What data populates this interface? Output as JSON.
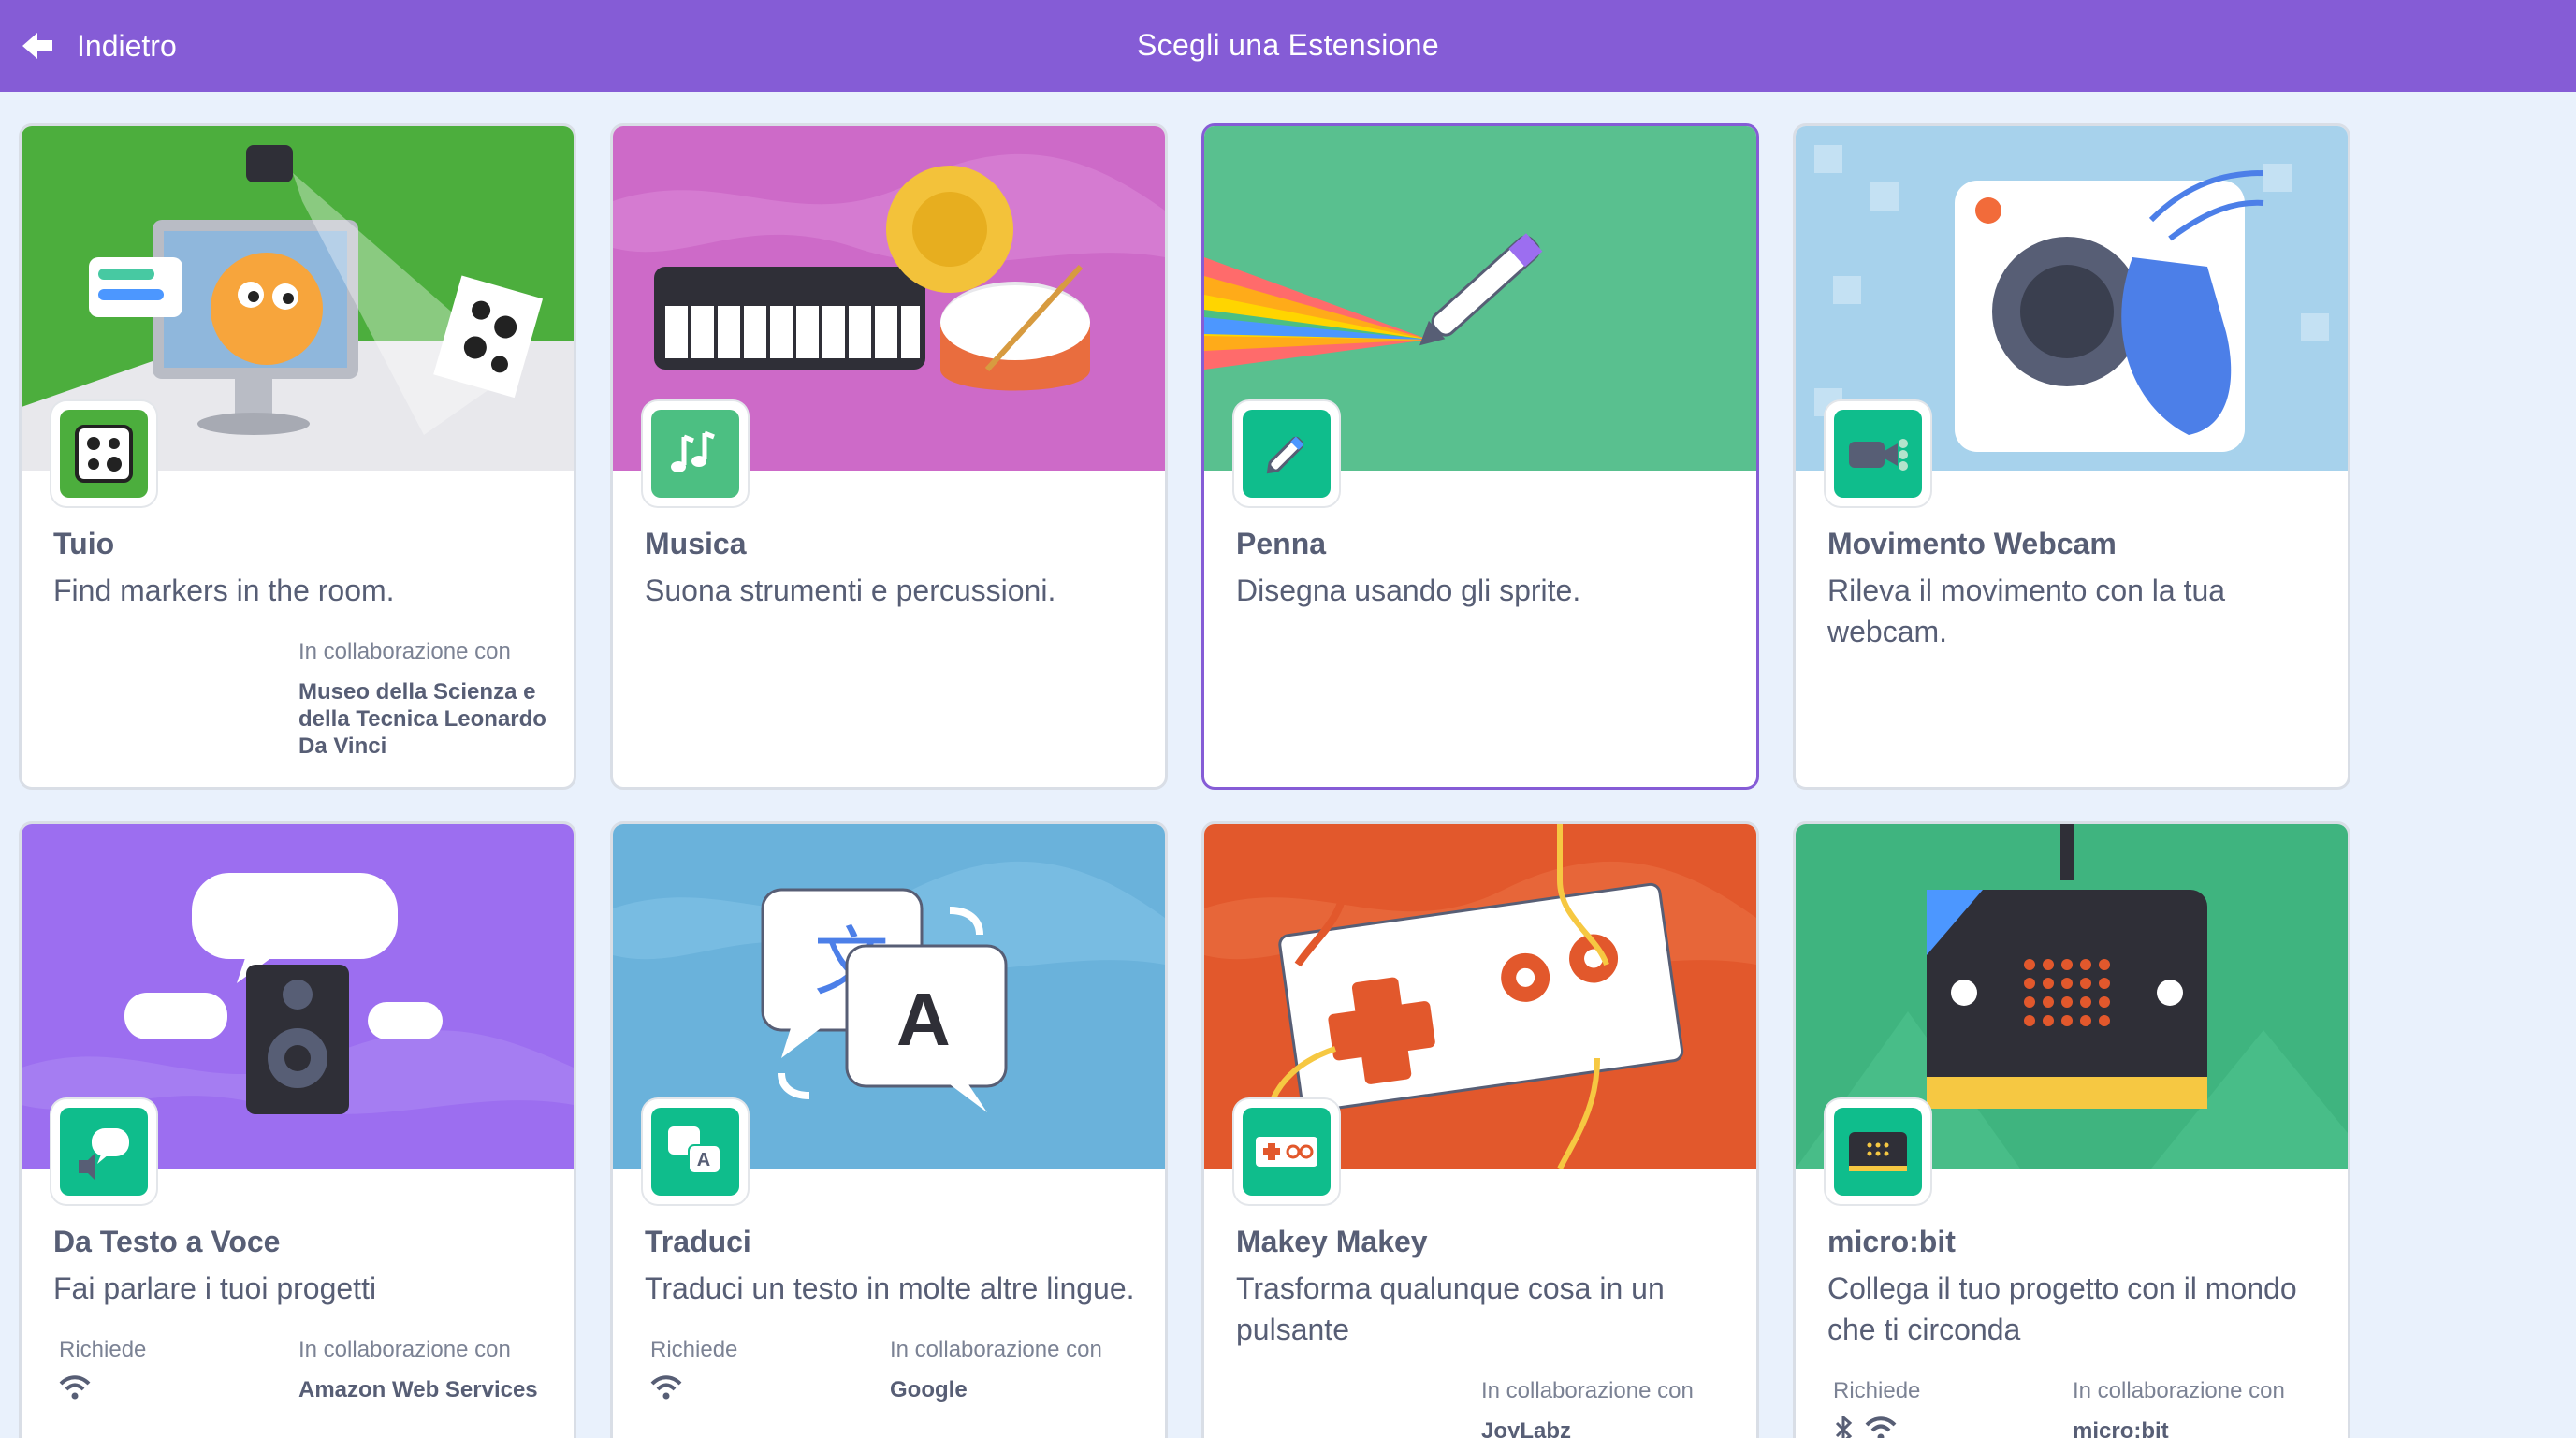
{
  "header": {
    "back_label": "Indietro",
    "title": "Scegli una Estensione",
    "color": "#855cd6"
  },
  "cards": [
    {
      "title": "Tuio",
      "description": "Find markers in the room.",
      "collab_label": "In collaborazione con",
      "collab_name": "Museo della Scienza e della Tecnica Leonardo Da Vinci",
      "bg": "#4cae3d",
      "icon": "tuio-marker-icon"
    },
    {
      "title": "Musica",
      "description": "Suona strumenti e percussioni.",
      "bg": "#cd6ac8",
      "icon": "music-notes-icon"
    },
    {
      "title": "Penna",
      "description": "Disegna usando gli sprite.",
      "bg": "#59c08f",
      "icon": "pen-icon",
      "selected": true
    },
    {
      "title": "Movimento Webcam",
      "description": "Rileva il movimento con la tua webcam.",
      "bg": "#a7d2ec",
      "icon": "video-sensing-icon"
    },
    {
      "title": "Da Testo a Voce",
      "description": "Fai parlare i tuoi progetti",
      "requires_label": "Richiede",
      "requires": [
        "wifi-icon"
      ],
      "collab_label": "In collaborazione con",
      "collab_name": "Amazon Web Services",
      "bg": "#9c6ef0",
      "icon": "speech-bubble-icon"
    },
    {
      "title": "Traduci",
      "description": "Traduci un testo in molte altre lingue.",
      "requires_label": "Richiede",
      "requires": [
        "wifi-icon"
      ],
      "collab_label": "In collaborazione con",
      "collab_name": "Google",
      "bg": "#6ab2db",
      "icon": "translate-icon"
    },
    {
      "title": "Makey Makey",
      "description": "Trasforma qualunque cosa in un pulsante",
      "collab_label": "In collaborazione con",
      "collab_name": "JoyLabz",
      "bg": "#e2582c",
      "icon": "makey-makey-icon"
    },
    {
      "title": "micro:bit",
      "description": "Collega il tuo progetto con il mondo che ti circonda",
      "requires_label": "Richiede",
      "requires": [
        "bluetooth-icon",
        "wifi-icon"
      ],
      "collab_label": "In collaborazione con",
      "collab_name": "micro:bit",
      "bg": "#3fb47f",
      "icon": "microbit-icon"
    }
  ]
}
